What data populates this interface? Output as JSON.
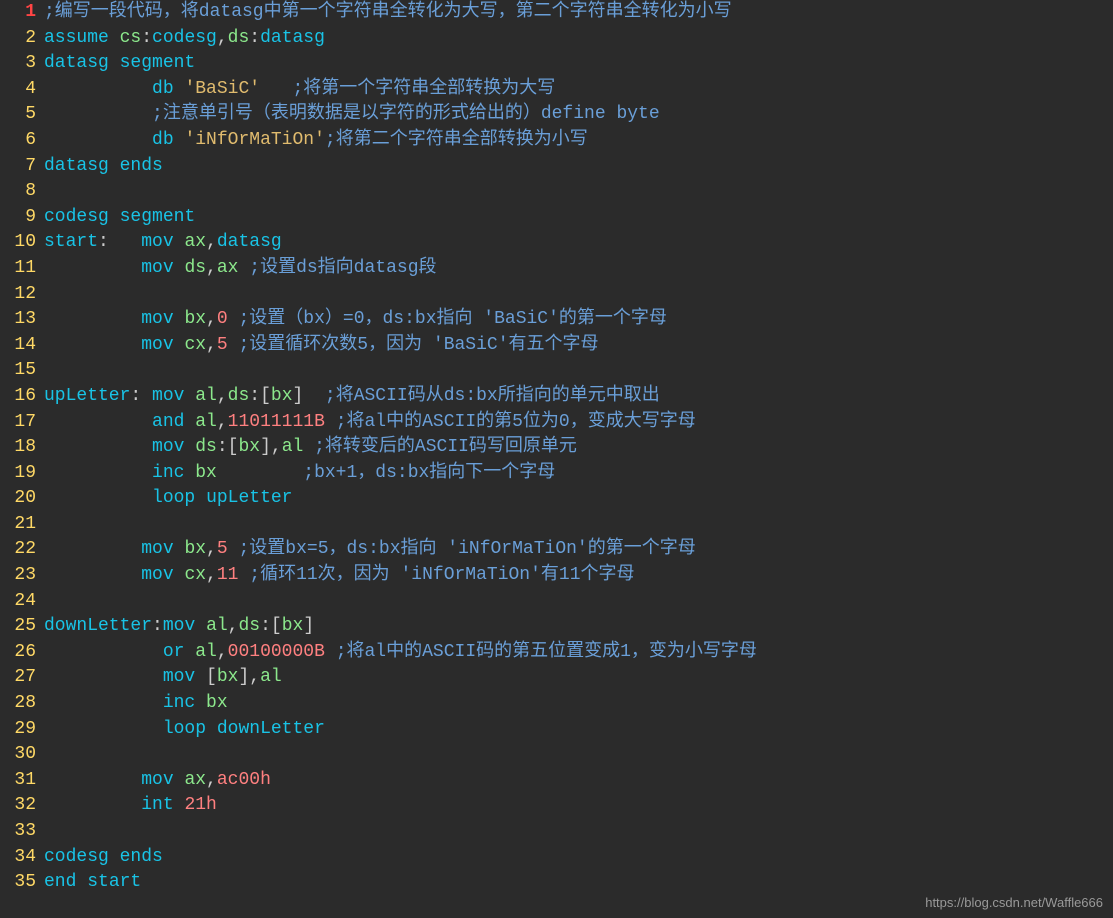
{
  "watermark": "https://blog.csdn.net/Waffle666",
  "lines": [
    {
      "n": 1,
      "hl": true,
      "tokens": [
        [
          "cm",
          ";编写一段代码，将datasg中第一个字符串全转化为大写，第二个字符串全转化为小写"
        ]
      ]
    },
    {
      "n": 2,
      "tokens": [
        [
          "kw",
          "assume"
        ],
        [
          "pn",
          " "
        ],
        [
          "rg",
          "cs"
        ],
        [
          "pn",
          ":"
        ],
        [
          "lb",
          "codesg"
        ],
        [
          "pn",
          ","
        ],
        [
          "rg",
          "ds"
        ],
        [
          "pn",
          ":"
        ],
        [
          "lb",
          "datasg"
        ]
      ]
    },
    {
      "n": 3,
      "tokens": [
        [
          "lb",
          "datasg"
        ],
        [
          "pn",
          " "
        ],
        [
          "kw",
          "segment"
        ]
      ]
    },
    {
      "n": 4,
      "tokens": [
        [
          "pn",
          "          "
        ],
        [
          "kw",
          "db"
        ],
        [
          "pn",
          " "
        ],
        [
          "st",
          "'BaSiC'"
        ],
        [
          "pn",
          "   "
        ],
        [
          "cm",
          ";将第一个字符串全部转换为大写"
        ]
      ]
    },
    {
      "n": 5,
      "tokens": [
        [
          "pn",
          "          "
        ],
        [
          "cm",
          ";注意单引号（表明数据是以字符的形式给出的）define byte"
        ]
      ]
    },
    {
      "n": 6,
      "tokens": [
        [
          "pn",
          "          "
        ],
        [
          "kw",
          "db"
        ],
        [
          "pn",
          " "
        ],
        [
          "st",
          "'iNfOrMaTiOn'"
        ],
        [
          "cm",
          ";将第二个字符串全部转换为小写"
        ]
      ]
    },
    {
      "n": 7,
      "tokens": [
        [
          "lb",
          "datasg"
        ],
        [
          "pn",
          " "
        ],
        [
          "kw",
          "ends"
        ]
      ]
    },
    {
      "n": 8,
      "tokens": [
        [
          "pn",
          " "
        ]
      ]
    },
    {
      "n": 9,
      "tokens": [
        [
          "lb",
          "codesg"
        ],
        [
          "pn",
          " "
        ],
        [
          "kw",
          "segment"
        ]
      ]
    },
    {
      "n": 10,
      "tokens": [
        [
          "lb",
          "start"
        ],
        [
          "pn",
          ":   "
        ],
        [
          "kw",
          "mov"
        ],
        [
          "pn",
          " "
        ],
        [
          "rg",
          "ax"
        ],
        [
          "pn",
          ","
        ],
        [
          "lb",
          "datasg"
        ]
      ]
    },
    {
      "n": 11,
      "tokens": [
        [
          "pn",
          "         "
        ],
        [
          "kw",
          "mov"
        ],
        [
          "pn",
          " "
        ],
        [
          "rg",
          "ds"
        ],
        [
          "pn",
          ","
        ],
        [
          "rg",
          "ax"
        ],
        [
          "pn",
          " "
        ],
        [
          "cm",
          ";设置ds指向datasg段"
        ]
      ]
    },
    {
      "n": 12,
      "tokens": [
        [
          "pn",
          " "
        ]
      ]
    },
    {
      "n": 13,
      "tokens": [
        [
          "pn",
          "         "
        ],
        [
          "kw",
          "mov"
        ],
        [
          "pn",
          " "
        ],
        [
          "rg",
          "bx"
        ],
        [
          "pn",
          ","
        ],
        [
          "nm",
          "0"
        ],
        [
          "pn",
          " "
        ],
        [
          "cm",
          ";设置（bx）=0，ds:bx指向 'BaSiC'的第一个字母"
        ]
      ]
    },
    {
      "n": 14,
      "tokens": [
        [
          "pn",
          "         "
        ],
        [
          "kw",
          "mov"
        ],
        [
          "pn",
          " "
        ],
        [
          "rg",
          "cx"
        ],
        [
          "pn",
          ","
        ],
        [
          "nm",
          "5"
        ],
        [
          "pn",
          " "
        ],
        [
          "cm",
          ";设置循环次数5，因为 'BaSiC'有五个字母"
        ]
      ]
    },
    {
      "n": 15,
      "tokens": [
        [
          "pn",
          " "
        ]
      ]
    },
    {
      "n": 16,
      "tokens": [
        [
          "lb",
          "upLetter"
        ],
        [
          "pn",
          ": "
        ],
        [
          "kw",
          "mov"
        ],
        [
          "pn",
          " "
        ],
        [
          "rg",
          "al"
        ],
        [
          "pn",
          ","
        ],
        [
          "rg",
          "ds"
        ],
        [
          "pn",
          ":["
        ],
        [
          "rg",
          "bx"
        ],
        [
          "pn",
          "]  "
        ],
        [
          "cm",
          ";将ASCII码从ds:bx所指向的单元中取出"
        ]
      ]
    },
    {
      "n": 17,
      "tokens": [
        [
          "pn",
          "          "
        ],
        [
          "kw",
          "and"
        ],
        [
          "pn",
          " "
        ],
        [
          "rg",
          "al"
        ],
        [
          "pn",
          ","
        ],
        [
          "nm",
          "11011111B"
        ],
        [
          "pn",
          " "
        ],
        [
          "cm",
          ";将al中的ASCII的第5位为0，变成大写字母"
        ]
      ]
    },
    {
      "n": 18,
      "tokens": [
        [
          "pn",
          "          "
        ],
        [
          "kw",
          "mov"
        ],
        [
          "pn",
          " "
        ],
        [
          "rg",
          "ds"
        ],
        [
          "pn",
          ":["
        ],
        [
          "rg",
          "bx"
        ],
        [
          "pn",
          "],"
        ],
        [
          "rg",
          "al"
        ],
        [
          "pn",
          " "
        ],
        [
          "cm",
          ";将转变后的ASCII码写回原单元"
        ]
      ]
    },
    {
      "n": 19,
      "tokens": [
        [
          "pn",
          "          "
        ],
        [
          "kw",
          "inc"
        ],
        [
          "pn",
          " "
        ],
        [
          "rg",
          "bx"
        ],
        [
          "pn",
          "        "
        ],
        [
          "cm",
          ";bx+1，ds:bx指向下一个字母"
        ]
      ]
    },
    {
      "n": 20,
      "tokens": [
        [
          "pn",
          "          "
        ],
        [
          "kw",
          "loop"
        ],
        [
          "pn",
          " "
        ],
        [
          "lb",
          "upLetter"
        ]
      ]
    },
    {
      "n": 21,
      "tokens": [
        [
          "pn",
          " "
        ]
      ]
    },
    {
      "n": 22,
      "tokens": [
        [
          "pn",
          "         "
        ],
        [
          "kw",
          "mov"
        ],
        [
          "pn",
          " "
        ],
        [
          "rg",
          "bx"
        ],
        [
          "pn",
          ","
        ],
        [
          "nm",
          "5"
        ],
        [
          "pn",
          " "
        ],
        [
          "cm",
          ";设置bx=5，ds:bx指向 'iNfOrMaTiOn'的第一个字母"
        ]
      ]
    },
    {
      "n": 23,
      "tokens": [
        [
          "pn",
          "         "
        ],
        [
          "kw",
          "mov"
        ],
        [
          "pn",
          " "
        ],
        [
          "rg",
          "cx"
        ],
        [
          "pn",
          ","
        ],
        [
          "nm",
          "11"
        ],
        [
          "pn",
          " "
        ],
        [
          "cm",
          ";循环11次，因为 'iNfOrMaTiOn'有11个字母"
        ]
      ]
    },
    {
      "n": 24,
      "tokens": [
        [
          "pn",
          " "
        ]
      ]
    },
    {
      "n": 25,
      "tokens": [
        [
          "lb",
          "downLetter"
        ],
        [
          "pn",
          ":"
        ],
        [
          "kw",
          "mov"
        ],
        [
          "pn",
          " "
        ],
        [
          "rg",
          "al"
        ],
        [
          "pn",
          ","
        ],
        [
          "rg",
          "ds"
        ],
        [
          "pn",
          ":["
        ],
        [
          "rg",
          "bx"
        ],
        [
          "pn",
          "]"
        ]
      ]
    },
    {
      "n": 26,
      "tokens": [
        [
          "pn",
          "           "
        ],
        [
          "kw",
          "or"
        ],
        [
          "pn",
          " "
        ],
        [
          "rg",
          "al"
        ],
        [
          "pn",
          ","
        ],
        [
          "nm",
          "00100000B"
        ],
        [
          "pn",
          " "
        ],
        [
          "cm",
          ";将al中的ASCII码的第五位置变成1，变为小写字母"
        ]
      ]
    },
    {
      "n": 27,
      "tokens": [
        [
          "pn",
          "           "
        ],
        [
          "kw",
          "mov"
        ],
        [
          "pn",
          " ["
        ],
        [
          "rg",
          "bx"
        ],
        [
          "pn",
          "],"
        ],
        [
          "rg",
          "al"
        ]
      ]
    },
    {
      "n": 28,
      "tokens": [
        [
          "pn",
          "           "
        ],
        [
          "kw",
          "inc"
        ],
        [
          "pn",
          " "
        ],
        [
          "rg",
          "bx"
        ]
      ]
    },
    {
      "n": 29,
      "tokens": [
        [
          "pn",
          "           "
        ],
        [
          "kw",
          "loop"
        ],
        [
          "pn",
          " "
        ],
        [
          "lb",
          "downLetter"
        ]
      ]
    },
    {
      "n": 30,
      "tokens": [
        [
          "pn",
          " "
        ]
      ]
    },
    {
      "n": 31,
      "tokens": [
        [
          "pn",
          "         "
        ],
        [
          "kw",
          "mov"
        ],
        [
          "pn",
          " "
        ],
        [
          "rg",
          "ax"
        ],
        [
          "pn",
          ","
        ],
        [
          "nm",
          "ac00h"
        ]
      ]
    },
    {
      "n": 32,
      "tokens": [
        [
          "pn",
          "         "
        ],
        [
          "kw",
          "int"
        ],
        [
          "pn",
          " "
        ],
        [
          "nm",
          "21h"
        ]
      ]
    },
    {
      "n": 33,
      "tokens": [
        [
          "pn",
          " "
        ]
      ]
    },
    {
      "n": 34,
      "tokens": [
        [
          "lb",
          "codesg"
        ],
        [
          "pn",
          " "
        ],
        [
          "kw",
          "ends"
        ]
      ]
    },
    {
      "n": 35,
      "tokens": [
        [
          "kw",
          "end"
        ],
        [
          "pn",
          " "
        ],
        [
          "lb",
          "start"
        ]
      ]
    }
  ]
}
